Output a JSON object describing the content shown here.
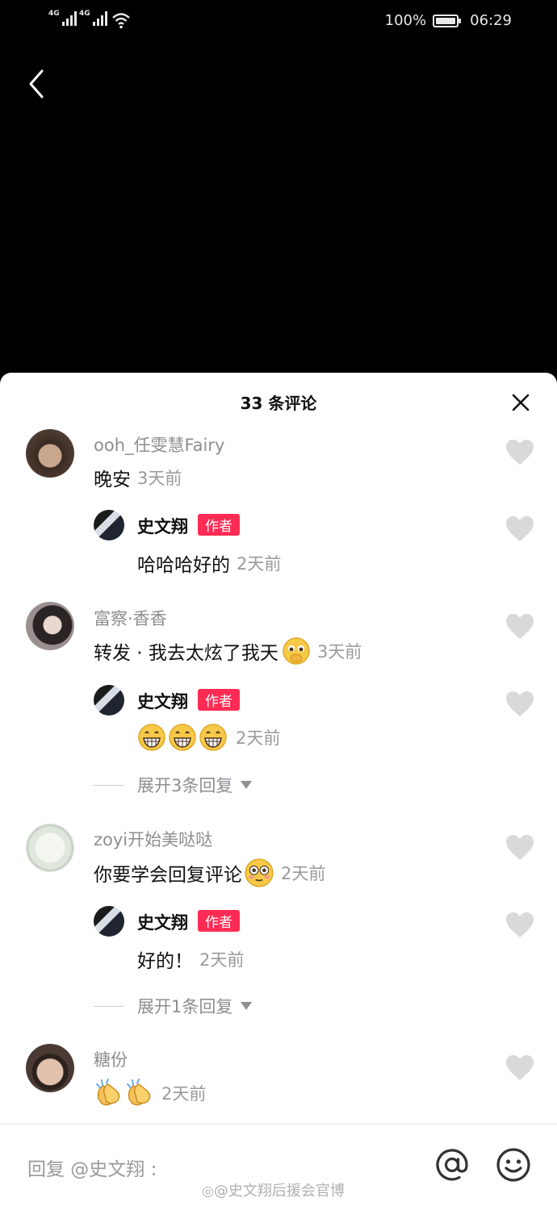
{
  "status_bar": {
    "signal1": "4G",
    "signal2": "4G",
    "battery_pct": "100%",
    "time": "06:29"
  },
  "sheet": {
    "title": "33 条评论"
  },
  "comments": [
    {
      "user": "ooh_任雯慧Fairy",
      "text": "晚安",
      "time": "3天前",
      "reply": {
        "user": "史文翔",
        "badge": "作者",
        "text": "哈哈哈好的",
        "time": "2天前"
      }
    },
    {
      "user": "富察·香香",
      "text": "转发 · 我去太炫了我天",
      "time": "3天前",
      "reply": {
        "user": "史文翔",
        "badge": "作者",
        "text": "",
        "time": "2天前"
      },
      "expand": "展开3条回复"
    },
    {
      "user": "zoyi开始美哒哒",
      "text": "你要学会回复评论",
      "time": "2天前",
      "reply": {
        "user": "史文翔",
        "badge": "作者",
        "text": "好的！",
        "time": "2天前"
      },
      "expand": "展开1条回复"
    },
    {
      "user": "糖份",
      "text": "",
      "time": "2天前"
    }
  ],
  "reply_bar": {
    "placeholder": "回复 @史文翔 :",
    "watermark": "@史文翔后援会官博"
  },
  "colors": {
    "accent": "#fe2c55",
    "muted": "#8e8e93"
  }
}
